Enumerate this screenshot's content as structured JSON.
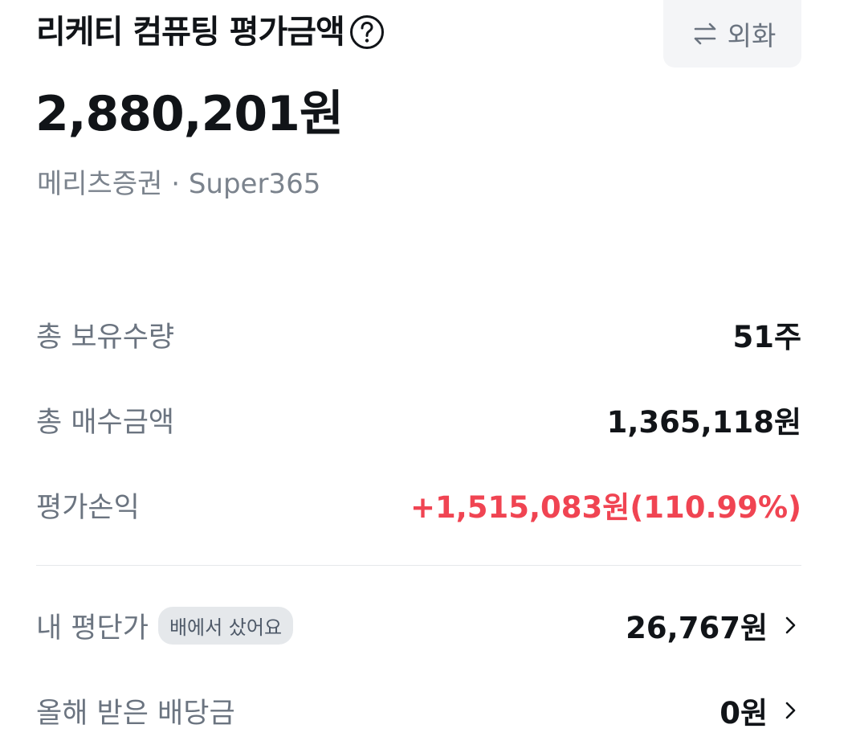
{
  "header": {
    "title": "리케티 컴퓨팅 평가금액",
    "help_icon": "question-circle-icon",
    "fx_button_label": "외화",
    "fx_icon": "swap-arrows-icon"
  },
  "summary": {
    "amount": "2,880,201원",
    "account": "메리츠증권 · Super365"
  },
  "stats": [
    {
      "label": "총 보유수량",
      "value": "51주"
    },
    {
      "label": "총 매수금액",
      "value": "1,365,118원"
    },
    {
      "label": "평가손익",
      "value": "+1,515,083원(110.99%)",
      "color": "#f04452"
    }
  ],
  "links": [
    {
      "label": "내 평단가",
      "badge": "배에서 샀어요",
      "value": "26,767원"
    },
    {
      "label": "올해 받은 배당금",
      "value": "0원"
    }
  ]
}
